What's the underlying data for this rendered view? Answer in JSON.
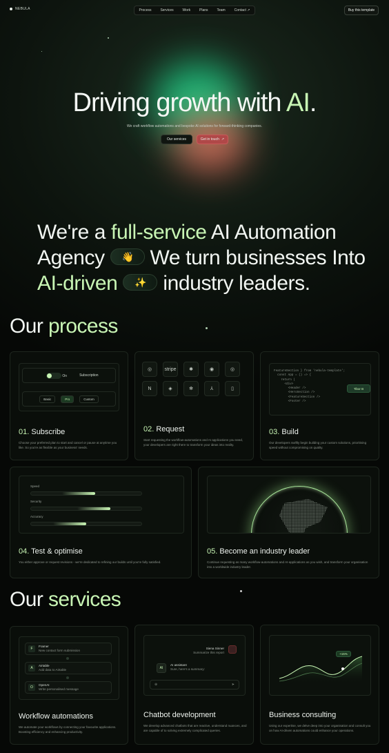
{
  "nav": {
    "logo": "NEBULA",
    "links": [
      "Process",
      "Services",
      "Work",
      "Plans",
      "Team",
      "Contact ↗"
    ],
    "cta": "Buy this template"
  },
  "hero": {
    "title_a": "Driving growth with ",
    "title_b": "AI",
    "title_c": ".",
    "subtitle": "We craft workflow automations and bespoke AI solutions for forward-thinking companies.",
    "btn_services": "Our services",
    "btn_touch": "Get in touch",
    "btn_touch_icon": "↗"
  },
  "statement": {
    "a": "We're a ",
    "b": "full-service",
    "c": " AI Automation Agency ",
    "d": " We turn businesses Into ",
    "e": "AI-driven",
    "f": " industry leaders.",
    "emoji1": "👋",
    "emoji2": "✨"
  },
  "process": {
    "h_a": "Our ",
    "h_b": "process",
    "subscribe": {
      "num": "01.",
      "title": " Subscribe",
      "desc": "Choose your preferred plan to start and cancel or pause at anytime you like. So you're as flexible as your business' needs.",
      "toggle": "On",
      "toggle_label": "Subscription",
      "plans": [
        "Basic",
        "Pro",
        "Custom"
      ]
    },
    "request": {
      "num": "02.",
      "title": " Request",
      "desc": "Start requesting the workflow-automations and AI applications you need, your developers are right there to transform your ideas into reality.",
      "logos": [
        "◎",
        "stripe",
        "✱",
        "◉",
        "◎",
        "N",
        "◈",
        "✻",
        "⅄",
        "▯"
      ]
    },
    "build": {
      "num": "03.",
      "title": " Build",
      "desc": "Our developers swiftly begin building your custom solutions, prioritising speed without compromising on quality.",
      "code": "FeatureSection } from 'nebula-template';\n  const App = () => {\n    return (\n      <div>\n        <Header />\n        <HeroSection />\n        <FeatureSection />\n        <Footer />",
      "tag": "Tibor B"
    },
    "test": {
      "num": "04.",
      "title": " Test & optimise",
      "desc": "You either approve or request revisions - we're dedicated to refining our builds until you're fully satisfied.",
      "bars": [
        {
          "label": "Speed",
          "value": 0.58
        },
        {
          "label": "Security",
          "value": 0.72
        },
        {
          "label": "Accuracy",
          "value": 0.5
        }
      ]
    },
    "leader": {
      "num": "05.",
      "title": " Become an industry leader",
      "desc": "Continue requesting as many workflow-automations and AI-applications as you wish, and transform your organisation into a worldwide industry leader."
    }
  },
  "services": {
    "h_a": "Our ",
    "h_b": "services",
    "workflow": {
      "title": "Workflow automations",
      "desc": "We automate your workflows by connecting your favourite applications. Boosting efficiency and enhancing productivity.",
      "items": [
        {
          "icon": "F",
          "name": "Framer",
          "sub": "New contact form submission"
        },
        {
          "icon": "A",
          "name": "Airtable",
          "sub": "Add data to Airtable"
        },
        {
          "icon": "O",
          "name": "OpenAI",
          "sub": "Write personalised message"
        }
      ]
    },
    "chatbot": {
      "title": "Chatbot development",
      "desc": "We develop advanced chatbots that are reactive, understand nuances, and are capable of to solving extremely complicated queries.",
      "user": "Siena Sinner",
      "user_msg": "Summarize this report",
      "ai_name": "AI assistant",
      "ai_msg": "Sure, here's a summary:",
      "ai_icon": "AI",
      "send": "➤",
      "attach": "⊕"
    },
    "consulting": {
      "title": "Business consulting",
      "desc": "Using our expertise, we delve deep into your organisation and consult you on how AI-driven automations could enhance your operations.",
      "badge": "+15%"
    }
  },
  "colors": {
    "accent": "#c8f5b4",
    "bg": "#050705"
  }
}
